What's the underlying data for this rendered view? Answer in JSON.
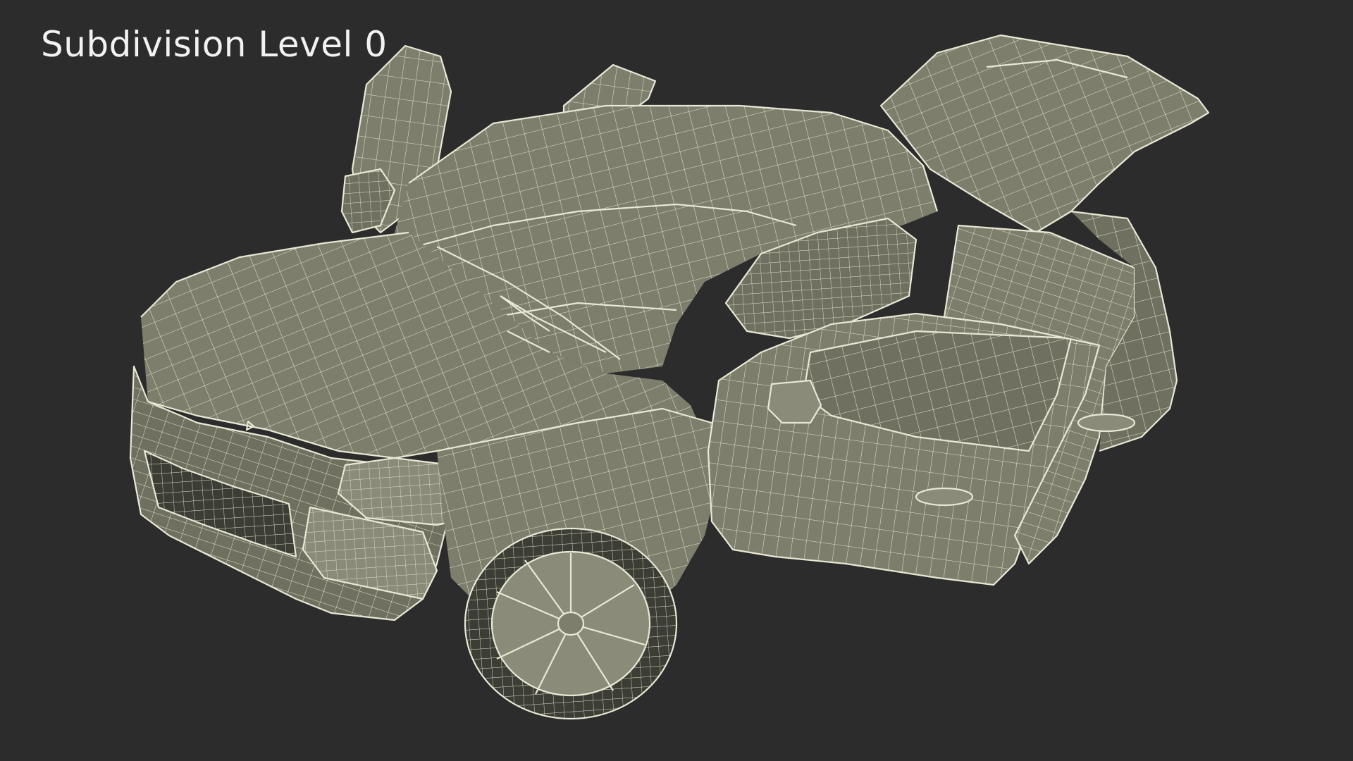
{
  "viewport": {
    "label": "Subdivision Level 0",
    "background_color": "#2c2c2c",
    "mesh_fill_color": "#7d7e6c",
    "wire_color": "#e9e8d6"
  },
  "model": {
    "subject": "car-wireframe",
    "open_parts": [
      "hood-doors-front",
      "front-right-door",
      "rear-right-door",
      "tailgate"
    ]
  }
}
